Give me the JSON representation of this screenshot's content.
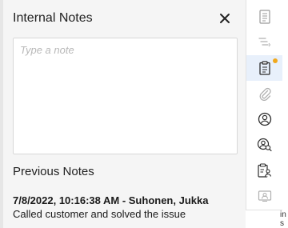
{
  "panel": {
    "title": "Internal Notes",
    "input_placeholder": "Type a note",
    "input_value": "",
    "previous_section_title": "Previous Notes",
    "previous_notes": [
      {
        "header": "7/8/2022, 10:16:38 AM - Suhonen, Jukka",
        "text": "Called customer and solved the issue"
      }
    ]
  },
  "rail": {
    "items": [
      {
        "icon": "document-list-icon",
        "active": false
      },
      {
        "icon": "sort-lines-icon",
        "active": false
      },
      {
        "icon": "clipboard-notes-icon",
        "active": true,
        "badge": true
      },
      {
        "icon": "paperclip-icon",
        "active": false
      },
      {
        "icon": "user-circle-icon",
        "active": false
      },
      {
        "icon": "user-search-icon",
        "active": false
      },
      {
        "icon": "clipboard-user-icon",
        "active": false
      },
      {
        "icon": "contact-card-icon",
        "active": false
      }
    ]
  },
  "background_fragments": [
    "in",
    "s",
    "s"
  ],
  "colors": {
    "panel_bg": "#f5f5f5",
    "active_rail_bg": "#e8f0fb",
    "badge": "#f0a81c",
    "icon_active": "#2b2b2b",
    "icon_muted": "#9a9a9a"
  }
}
